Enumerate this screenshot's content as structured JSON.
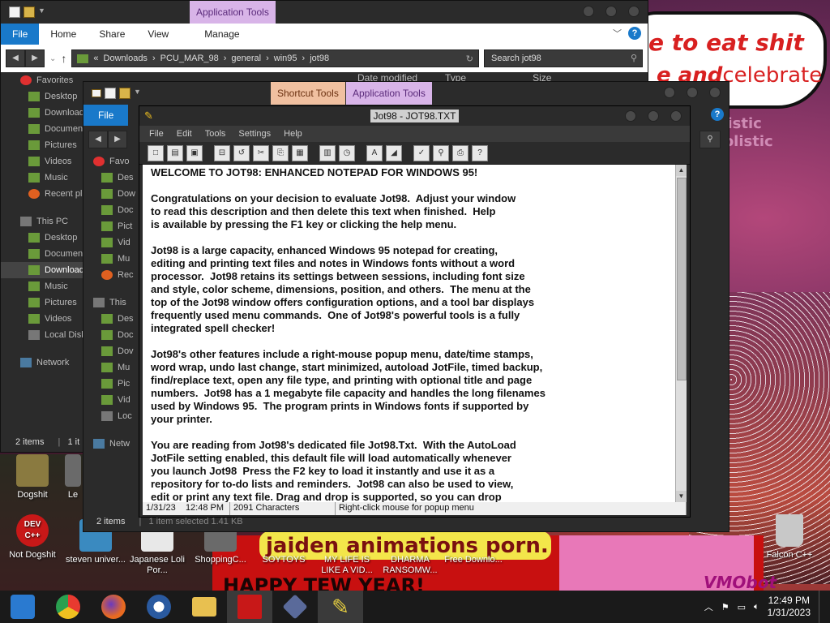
{
  "wallpaper": {
    "bubble_line1": "e to eat shit",
    "bubble_line2_bold": "e and",
    "bubble_line2_rest": "celebrate",
    "faint1": "rtistic",
    "faint2": "nolistic",
    "banner_text": "jaiden animations porn.",
    "banner_text2": "HAPPY TEW YEAR!",
    "banner_text3": "VMObot"
  },
  "desktop_icons": [
    {
      "label": "Dogshit",
      "color": "#8a7a40"
    },
    {
      "label": "Le",
      "color": "#6a6a6a"
    },
    {
      "label": "Not Dogshit",
      "color": "#c81818"
    },
    {
      "label": "steven univer...",
      "color": "#3a8ac0"
    },
    {
      "label": "Japanese Loli Por...",
      "color": "#e8e8e8"
    },
    {
      "label": "ShoppingC...",
      "color": "#6a6a6a"
    },
    {
      "label": "SOYTOYS",
      "color": "#c89030"
    },
    {
      "label": "MY LIFE IS LIKE A VID...",
      "color": "#d02020"
    },
    {
      "label": "DHARMA RANSOMW...",
      "color": "#303030"
    },
    {
      "label": "Free Downlo...",
      "color": "#f0c020"
    },
    {
      "label": "Falcon C++",
      "color": "#c8c8c8"
    }
  ],
  "dev_cpp": {
    "line1": "DEV",
    "line2": "C++"
  },
  "explorer1": {
    "ctx_tab": "Application Tools",
    "tabs": [
      "File",
      "Home",
      "Share",
      "View",
      "Manage"
    ],
    "breadcrumb": [
      "«",
      "Downloads",
      "›",
      "PCU_MAR_98",
      "›",
      "general",
      "›",
      "win95",
      "›",
      "jot98"
    ],
    "search_placeholder": "Search jot98",
    "columns": [
      "Date modified",
      "Type",
      "Size"
    ],
    "nav": [
      {
        "label": "Favorites",
        "kind": "head",
        "icon": "heart"
      },
      {
        "label": "Desktop",
        "kind": "item",
        "icon": "folder"
      },
      {
        "label": "Downloads",
        "kind": "item",
        "icon": "folder"
      },
      {
        "label": "Documents",
        "kind": "item",
        "icon": "folder"
      },
      {
        "label": "Pictures",
        "kind": "item",
        "icon": "folder"
      },
      {
        "label": "Videos",
        "kind": "item",
        "icon": "folder"
      },
      {
        "label": "Music",
        "kind": "item",
        "icon": "folder"
      },
      {
        "label": "Recent places",
        "kind": "item",
        "icon": "recent"
      },
      {
        "label": "",
        "kind": "gap"
      },
      {
        "label": "This PC",
        "kind": "head",
        "icon": "pc"
      },
      {
        "label": "Desktop",
        "kind": "item",
        "icon": "folder"
      },
      {
        "label": "Documents",
        "kind": "item",
        "icon": "folder"
      },
      {
        "label": "Downloads",
        "kind": "sel",
        "icon": "folder"
      },
      {
        "label": "Music",
        "kind": "item",
        "icon": "folder"
      },
      {
        "label": "Pictures",
        "kind": "item",
        "icon": "folder"
      },
      {
        "label": "Videos",
        "kind": "item",
        "icon": "folder"
      },
      {
        "label": "Local Disk",
        "kind": "item",
        "icon": "pc"
      },
      {
        "label": "",
        "kind": "gap"
      },
      {
        "label": "Network",
        "kind": "head",
        "icon": "net"
      }
    ],
    "status_items": "2 items",
    "status_selected": "1 it"
  },
  "explorer2": {
    "ctx_short": "Shortcut Tools",
    "ctx_app": "Application Tools",
    "file_tab": "File",
    "nav": [
      {
        "label": "Favo",
        "kind": "head",
        "icon": "heart"
      },
      {
        "label": "Des",
        "kind": "item",
        "icon": "folder"
      },
      {
        "label": "Dow",
        "kind": "item",
        "icon": "folder"
      },
      {
        "label": "Doc",
        "kind": "item",
        "icon": "folder"
      },
      {
        "label": "Pict",
        "kind": "item",
        "icon": "folder"
      },
      {
        "label": "Vid",
        "kind": "item",
        "icon": "folder"
      },
      {
        "label": "Mu",
        "kind": "item",
        "icon": "folder"
      },
      {
        "label": "Rec",
        "kind": "item",
        "icon": "recent"
      },
      {
        "label": "",
        "kind": "gap"
      },
      {
        "label": "This",
        "kind": "head",
        "icon": "pc"
      },
      {
        "label": "Des",
        "kind": "item",
        "icon": "folder"
      },
      {
        "label": "Doc",
        "kind": "item",
        "icon": "folder"
      },
      {
        "label": "Dov",
        "kind": "item",
        "icon": "folder"
      },
      {
        "label": "Mu",
        "kind": "item",
        "icon": "folder"
      },
      {
        "label": "Pic",
        "kind": "item",
        "icon": "folder"
      },
      {
        "label": "Vid",
        "kind": "item",
        "icon": "folder"
      },
      {
        "label": "Loc",
        "kind": "item",
        "icon": "pc"
      },
      {
        "label": "",
        "kind": "gap"
      },
      {
        "label": "Netw",
        "kind": "head",
        "icon": "net"
      }
    ],
    "status_items": "2 items",
    "status_selected": "1 item selected   1.41 KB"
  },
  "jot98": {
    "title": "Jot98 - JOT98.TXT",
    "menu": [
      "File",
      "Edit",
      "Tools",
      "Settings",
      "Help"
    ],
    "toolbar": [
      "new",
      "open",
      "save",
      "print-preview",
      "undo",
      "cut",
      "copy",
      "paste",
      "date",
      "time",
      "font",
      "color",
      "spell",
      "find",
      "print",
      "help"
    ],
    "text": "WELCOME TO JOT98: ENHANCED NOTEPAD FOR WINDOWS 95!\n\nCongratulations on your decision to evaluate Jot98.  Adjust your window\nto read this description and then delete this text when finished.  Help\nis available by pressing the F1 key or clicking the help menu.\n\nJot98 is a large capacity, enhanced Windows 95 notepad for creating,\nediting and printing text files and notes in Windows fonts without a word\nprocessor.  Jot98 retains its settings between sessions, including font size\nand style, color scheme, dimensions, position, and others.  The menu at the\ntop of the Jot98 window offers configuration options, and a tool bar displays\nfrequently used menu commands.  One of Jot98's powerful tools is a fully\nintegrated spell checker!\n\nJot98's other features include a right-mouse popup menu, date/time stamps,\nword wrap, undo last change, start minimized, autoload JotFile, timed backup,\nfind/replace text, open any file type, and printing with optional title and page\nnumbers.  Jot98 has a 1 megabyte file capacity and handles the long filenames\nused by Windows 95.  The program prints in Windows fonts if supported by\nyour printer.\n\nYou are reading from Jot98's dedicated file Jot98.Txt.  With the AutoLoad\nJotFile setting enabled, this default file will load automatically whenever\nyou launch Jot98  Press the F2 key to load it instantly and use it as a\nrepository for to-do lists and reminders.  Jot98 can also be used to view,\nedit or print any text file. Drag and drop is supported, so you can drop",
    "status_date": "1/31/23",
    "status_time": "12:48 PM",
    "status_chars": "2091 Characters",
    "status_hint": "Right-click mouse for popup menu"
  },
  "taskbar": {
    "apps": [
      {
        "name": "chrome-os-icon",
        "color": "#2a7ad0"
      },
      {
        "name": "chrome-icon",
        "color": "#e8b020"
      },
      {
        "name": "firefox-icon",
        "color": "#e86a20"
      },
      {
        "name": "obama-logo-icon",
        "color": "#2a5aa0"
      },
      {
        "name": "explorer-icon",
        "color": "#e8c050"
      },
      {
        "name": "red-app-icon",
        "color": "#c81818"
      },
      {
        "name": "diamond-app-icon",
        "color": "#5a6a9a"
      },
      {
        "name": "jot98-pencil-icon",
        "color": "#e8d040"
      }
    ],
    "time": "12:49 PM",
    "date": "1/31/2023"
  }
}
